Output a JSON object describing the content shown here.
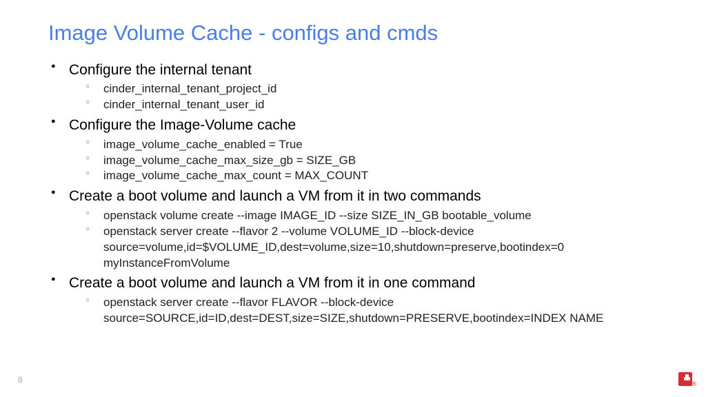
{
  "title": "Image Volume Cache - configs and cmds",
  "items": [
    {
      "label": "Configure the internal tenant",
      "subs": [
        "cinder_internal_tenant_project_id",
        "cinder_internal_tenant_user_id"
      ]
    },
    {
      "label": "Configure the Image-Volume cache",
      "subs": [
        "image_volume_cache_enabled = True",
        "image_volume_cache_max_size_gb = SIZE_GB",
        "image_volume_cache_max_count = MAX_COUNT"
      ]
    },
    {
      "label": "Create a boot volume and launch a VM from it in two commands",
      "subs": [
        "openstack volume create --image IMAGE_ID --size SIZE_IN_GB bootable_volume",
        "openstack server create --flavor 2 --volume VOLUME_ID --block-device source=volume,id=$VOLUME_ID,dest=volume,size=10,shutdown=preserve,bootindex=0 myInstanceFromVolume"
      ]
    },
    {
      "label": "Create a boot volume and launch a VM from it in one command",
      "subs": [
        "openstack server create --flavor FLAVOR --block-device source=SOURCE,id=ID,dest=DEST,size=SIZE,shutdown=PRESERVE,bootindex=INDEX NAME"
      ]
    }
  ],
  "pageNumber": "8"
}
